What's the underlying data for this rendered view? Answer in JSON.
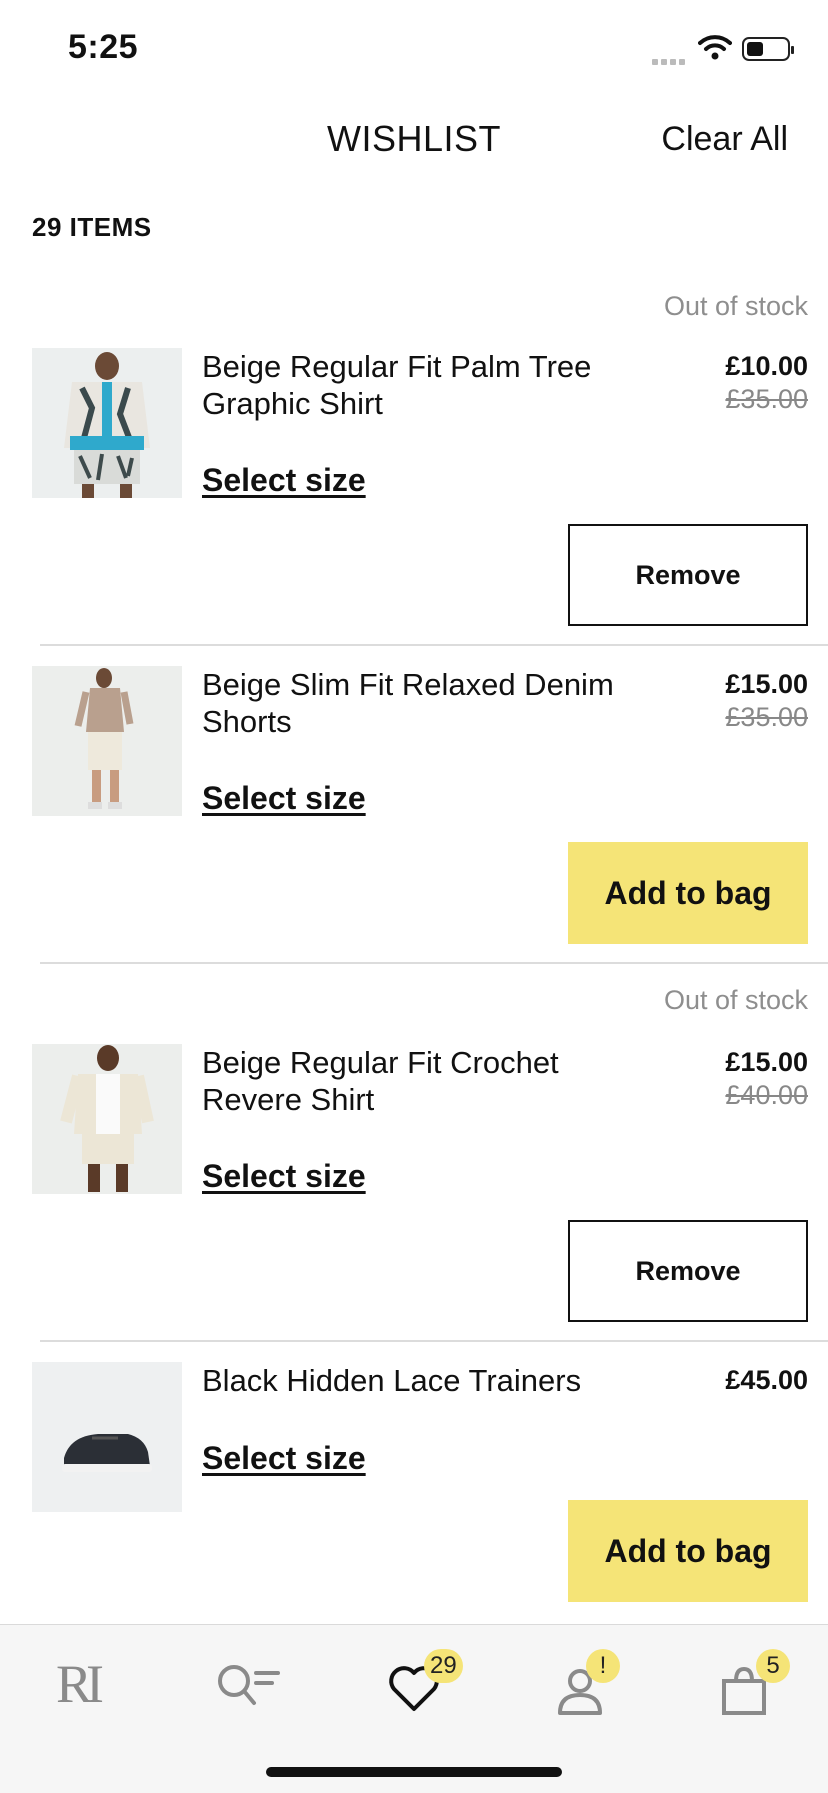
{
  "status_bar": {
    "time": "5:25"
  },
  "header": {
    "title": "WISHLIST",
    "clear_all": "Clear All"
  },
  "items_count": "29 ITEMS",
  "items": [
    {
      "name": "Beige Regular Fit Palm Tree Graphic Shirt",
      "stock_status": "Out of stock",
      "price": "£10.00",
      "was_price": "£35.00",
      "select_size": "Select size",
      "action": "Remove"
    },
    {
      "name": "Beige Slim Fit Relaxed Denim Shorts",
      "stock_status": "",
      "price": "£15.00",
      "was_price": "£35.00",
      "select_size": "Select size",
      "action": "Add to bag"
    },
    {
      "name": "Beige Regular Fit Crochet Revere Shirt",
      "stock_status": "Out of stock",
      "price": "£15.00",
      "was_price": "£40.00",
      "select_size": "Select size",
      "action": "Remove"
    },
    {
      "name": "Black Hidden Lace Trainers",
      "stock_status": "",
      "price": "£45.00",
      "was_price": "",
      "select_size": "Select size",
      "action": "Add to bag"
    }
  ],
  "tabbar": {
    "logo_text": "RI",
    "wishlist_badge": "29",
    "account_badge": "!",
    "bag_badge": "5"
  },
  "colors": {
    "accent": "#f5e477",
    "muted": "#8e8e8e",
    "divider": "#dcdcdc"
  }
}
